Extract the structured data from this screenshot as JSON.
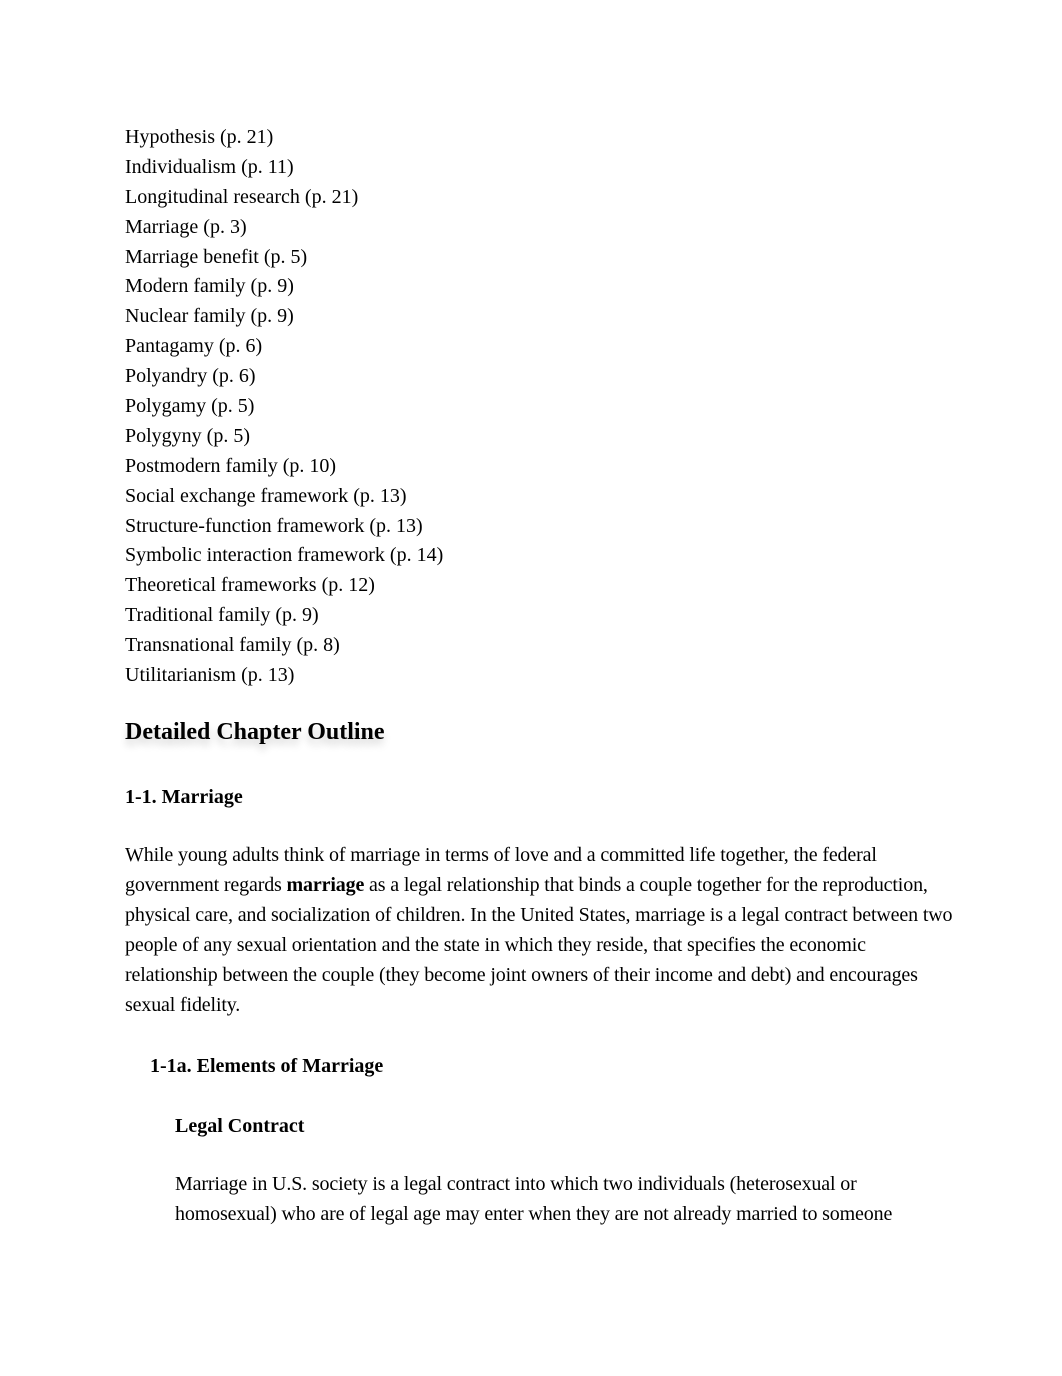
{
  "key_terms": [
    "Hypothesis (p. 21)",
    "Individualism (p. 11)",
    "Longitudinal research (p. 21)",
    "Marriage (p. 3)",
    "Marriage benefit (p. 5)",
    "Modern family (p. 9)",
    "Nuclear family (p. 9)",
    "Pantagamy (p. 6)",
    "Polyandry (p. 6)",
    "Polygamy (p. 5)",
    "Polygyny (p. 5)",
    "Postmodern family (p. 10)",
    "Social exchange framework (p. 13)",
    "Structure-function framework (p. 13)",
    "Symbolic interaction framework (p. 14)",
    "Theoretical frameworks (p. 12)",
    "Traditional family (p. 9)",
    "Transnational family (p. 8)",
    "Utilitarianism (p. 13)"
  ],
  "outline": {
    "title": "Detailed Chapter Outline",
    "section": {
      "heading": "1-1. Marriage",
      "paragraph": {
        "before_bold": "While young adults think of marriage in terms of love and a committed life together, the federal government regards ",
        "bold": "marriage",
        "after_bold": " as a legal relationship that binds a couple together for the reproduction, physical care, and socialization of children. In the United States, marriage is a legal contract between two people of any sexual orientation and the state in which they reside, that specifies the economic relationship between the couple (they become joint owners of their income and debt) and encourages sexual fidelity."
      }
    },
    "subsection": {
      "heading": "1-1a. Elements of Marriage",
      "subheading": "Legal Contract",
      "paragraph": "Marriage in U.S. society is a legal contract into which two individuals (heterosexual or homosexual) who are of legal age may enter when they are not already married to someone"
    }
  }
}
